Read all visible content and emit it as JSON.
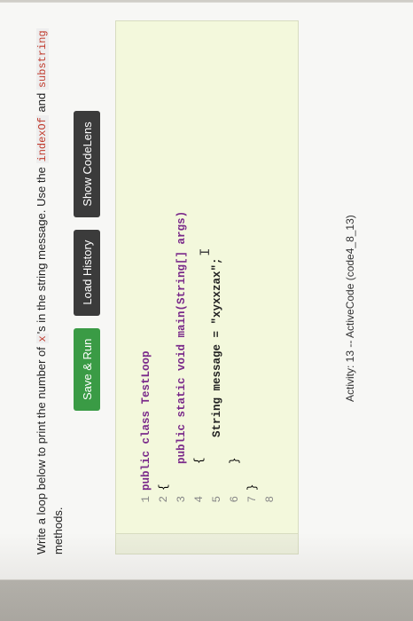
{
  "prompt": {
    "before": "Write a loop below to print the number of ",
    "code_x": "x",
    "middle": "'s in the string message. Use the ",
    "code_indexof": "indexOf",
    "and": " and ",
    "code_substring": "substring",
    "after": " methods."
  },
  "toolbar": {
    "save_run": "Save & Run",
    "load_history": "Load History",
    "show_codelens": "Show CodeLens"
  },
  "editor": {
    "lines": [
      {
        "num": "1",
        "text": "public class TestLoop"
      },
      {
        "num": "2",
        "text": "{"
      },
      {
        "num": "3",
        "text": "    public static void main(String[] args)"
      },
      {
        "num": "4",
        "text": "    {"
      },
      {
        "num": "5",
        "text": "        String message = \"xyxxzax\";"
      },
      {
        "num": "6",
        "text": "    }"
      },
      {
        "num": "7",
        "text": "}"
      },
      {
        "num": "8",
        "text": ""
      }
    ]
  },
  "activity": "Activity: 13 -- ActiveCode (code4_8_13)"
}
